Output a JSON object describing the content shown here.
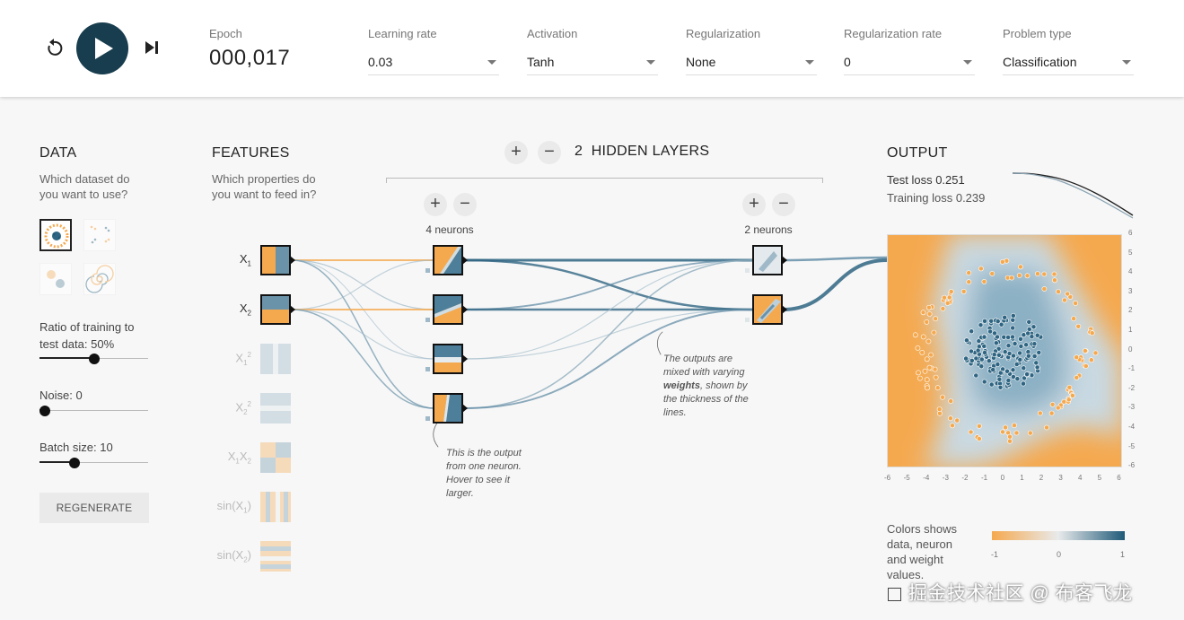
{
  "header": {
    "epoch_label": "Epoch",
    "epoch_value": "000,017",
    "controls": [
      {
        "name": "reset-icon",
        "icon": "reset-icon"
      },
      {
        "name": "play-icon",
        "icon": "play-icon"
      },
      {
        "name": "step-icon",
        "icon": "step-forward-icon"
      }
    ],
    "dropdowns": [
      {
        "label": "Learning rate",
        "value": "0.03"
      },
      {
        "label": "Activation",
        "value": "Tanh"
      },
      {
        "label": "Regularization",
        "value": "None"
      },
      {
        "label": "Regularization rate",
        "value": "0"
      },
      {
        "label": "Problem type",
        "value": "Classification"
      }
    ]
  },
  "data": {
    "title": "DATA",
    "subtitle": "Which dataset do you want to use?",
    "datasets": [
      "circle",
      "xor",
      "gaussian",
      "spiral"
    ],
    "selected_dataset": "circle",
    "ratio_label": "Ratio of training to test data:",
    "ratio_value": "50%",
    "ratio_fraction": 0.5,
    "noise_label": "Noise:",
    "noise_value": "0",
    "noise_fraction": 0,
    "batch_label": "Batch size:",
    "batch_value": "10",
    "batch_fraction": 0.3,
    "regenerate_label": "REGENERATE"
  },
  "features": {
    "title": "FEATURES",
    "subtitle": "Which properties do you want to feed in?",
    "items": [
      {
        "label": "X1",
        "active": true
      },
      {
        "label": "X2",
        "active": true
      },
      {
        "label": "X1²",
        "active": false
      },
      {
        "label": "X2²",
        "active": false
      },
      {
        "label": "X1X2",
        "active": false
      },
      {
        "label": "sin(X1)",
        "active": false
      },
      {
        "label": "sin(X2)",
        "active": false
      }
    ]
  },
  "network": {
    "hidden_layers_count": "2",
    "hidden_layers_label": "HIDDEN LAYERS",
    "layers": [
      {
        "neurons_label": "4 neurons",
        "neurons": 4
      },
      {
        "neurons_label": "2 neurons",
        "neurons": 2
      }
    ],
    "note_neuron": "This is the output from one neuron. Hover to see it larger.",
    "note_neuron_bold": "neuron",
    "note_weights_pre": "The outputs are mixed with varying",
    "note_weights_bold": "weights",
    "note_weights_post": ", shown by the thickness of the lines."
  },
  "output": {
    "title": "OUTPUT",
    "test_loss_label": "Test loss",
    "test_loss": "0.251",
    "training_loss_label": "Training loss",
    "training_loss": "0.239",
    "x_ticks": [
      "-6",
      "-5",
      "-4",
      "-3",
      "-2",
      "-1",
      "0",
      "1",
      "2",
      "3",
      "4",
      "5",
      "6"
    ],
    "y_ticks": [
      "6",
      "5",
      "4",
      "3",
      "2",
      "1",
      "0",
      "-1",
      "-2",
      "-3",
      "-4",
      "-5",
      "-6"
    ],
    "legend_text": "Colors shows data, neuron and weight values.",
    "legend_ticks": [
      "-1",
      "0",
      "1"
    ],
    "colors": {
      "negative": "#f5a94f",
      "positive": "#1f5a78",
      "neutral": "#e8eaeb"
    }
  },
  "watermark": "掘金技术社区 @ 布客飞龙"
}
